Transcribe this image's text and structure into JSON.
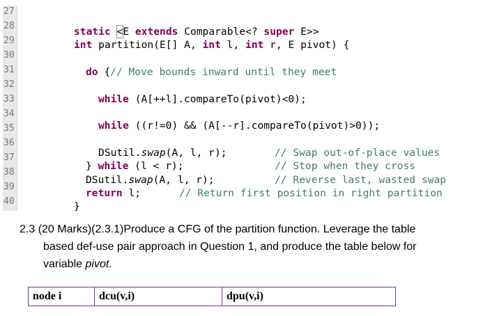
{
  "line_numbers": [
    "27",
    "28",
    "29",
    "30",
    "31",
    "32",
    "33",
    "34",
    "35",
    "36",
    "37",
    "38",
    "39",
    "40"
  ],
  "code": {
    "l27_kw1": "static",
    "l27_caret": "<",
    "l27_t1": "E ",
    "l27_kw2": "extends",
    "l27_t2": " Comparable<? ",
    "l27_kw3": "super",
    "l27_t3": " E>>",
    "l28_kw1": "int",
    "l28_t1": " partition(E[] A, ",
    "l28_kw2": "int",
    "l28_t2": " l, ",
    "l28_kw3": "int",
    "l28_t3": " r, E pivot) {",
    "l30_kw": "do",
    "l30_t": " {",
    "l30_cm": "// Move bounds inward until they meet",
    "l32_kw": "while",
    "l32_t": " (A[++l].compareTo(pivot)<0);",
    "l34_kw": "while",
    "l34_t": " ((r!=0) && (A[--r].compareTo(pivot)>0));",
    "l36_t1": "DSutil.",
    "l36_it": "swap",
    "l36_t2": "(A, l, r);",
    "l36_cm": "// Swap out-of-place values",
    "l37_t1": "} ",
    "l37_kw": "while",
    "l37_t2": " (l < r);",
    "l37_cm": "// Stop when they cross",
    "l38_t1": "DSutil.",
    "l38_it": "swap",
    "l38_t2": "(A, l, r);",
    "l38_cm": "// Reverse last, wasted swap",
    "l39_kw": "return",
    "l39_t": " l;",
    "l39_cm": "// Return first position in right partition",
    "l40_t": "}"
  },
  "question": {
    "line1": "2.3 (20 Marks)(2.3.1)Produce a CFG of the partition function.  Leverage the table",
    "line2": "based def-use pair approach in Question 1, and produce the table below for",
    "line3_pre": "variable ",
    "line3_var": "pivot",
    "line3_post": "."
  },
  "table": {
    "headers": [
      "node i",
      "dcu(v,i)",
      "dpu(v,i)"
    ]
  },
  "colors": {
    "keyword": "#7f0055",
    "comment": "#3f7f5f",
    "table_border": "#7030a0"
  }
}
